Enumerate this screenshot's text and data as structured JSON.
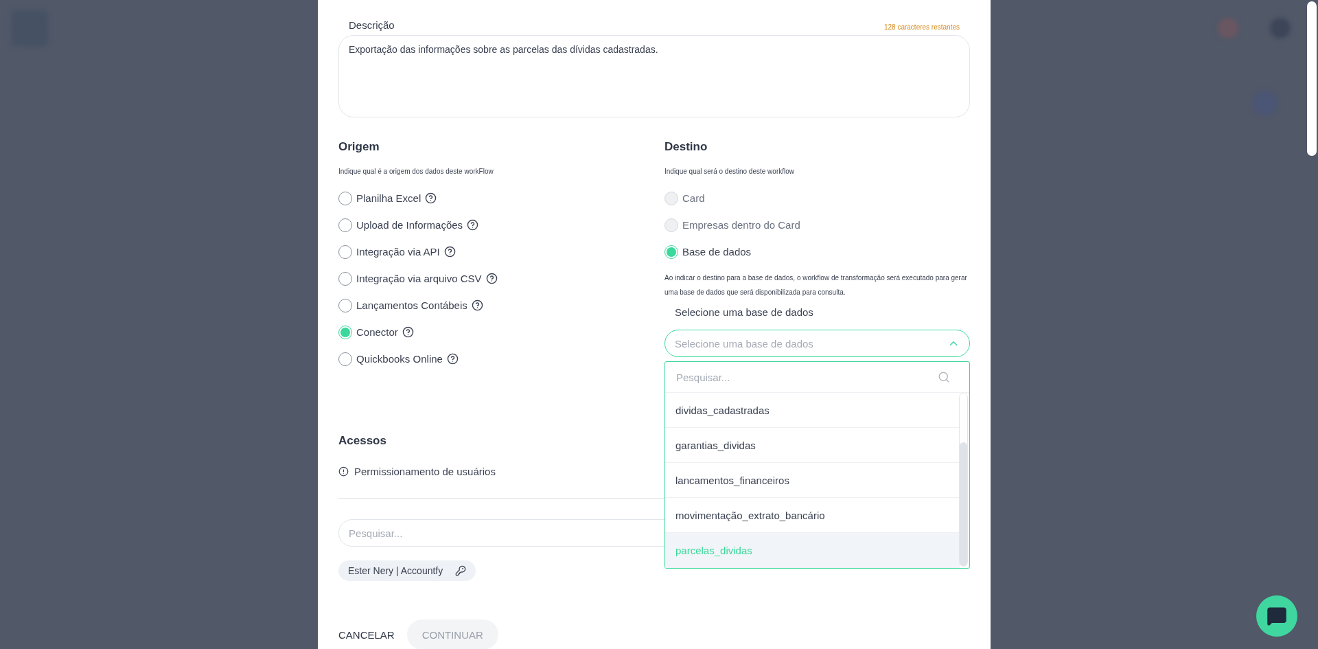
{
  "description": {
    "label": "Descrição",
    "counter": "128 caracteres restantes",
    "value": "Exportação das informações sobre as parcelas das dívidas cadastradas."
  },
  "origin": {
    "title": "Origem",
    "hint": "Indique qual é a origem dos dados deste workFlow",
    "options": [
      {
        "label": "Planilha Excel",
        "selected": false,
        "help": true
      },
      {
        "label": "Upload de Informações",
        "selected": false,
        "help": true
      },
      {
        "label": "Integração via API",
        "selected": false,
        "help": true
      },
      {
        "label": "Integração via arquivo CSV",
        "selected": false,
        "help": true
      },
      {
        "label": "Lançamentos Contábeis",
        "selected": false,
        "help": true
      },
      {
        "label": "Conector",
        "selected": true,
        "help": true
      },
      {
        "label": "Quickbooks Online",
        "selected": false,
        "help": true
      }
    ]
  },
  "destination": {
    "title": "Destino",
    "hint": "Indique qual será o destino deste workflow",
    "options": [
      {
        "label": "Card",
        "selected": false,
        "disabled": true
      },
      {
        "label": "Empresas dentro do Card",
        "selected": false,
        "disabled": true
      },
      {
        "label": "Base de dados",
        "selected": true,
        "disabled": false
      }
    ],
    "info": "Ao indicar o destino para a base de dados, o workflow de transformação será executado para gerar uma base de dados que será disponibilizada para consulta.",
    "select": {
      "label": "Selecione uma base de dados",
      "placeholder": "Selecione uma base de dados",
      "expanded": true,
      "search_placeholder": "Pesquisar...",
      "items": [
        {
          "label": "dividas_cadastradas",
          "selected": false
        },
        {
          "label": "garantias_dividas",
          "selected": false
        },
        {
          "label": "lancamentos_financeiros",
          "selected": false
        },
        {
          "label": "movimentação_extrato_bancário",
          "selected": false
        },
        {
          "label": "parcelas_dividas",
          "selected": true
        }
      ]
    }
  },
  "access": {
    "title": "Acessos",
    "permission": "Permissionamento de usuários",
    "search_placeholder": "Pesquisar...",
    "users": [
      {
        "label": "Ester Nery | Accountfy"
      }
    ]
  },
  "buttons": {
    "cancel": "CANCELAR",
    "continue": {
      "label": "CONTINUAR",
      "disabled": true
    }
  }
}
